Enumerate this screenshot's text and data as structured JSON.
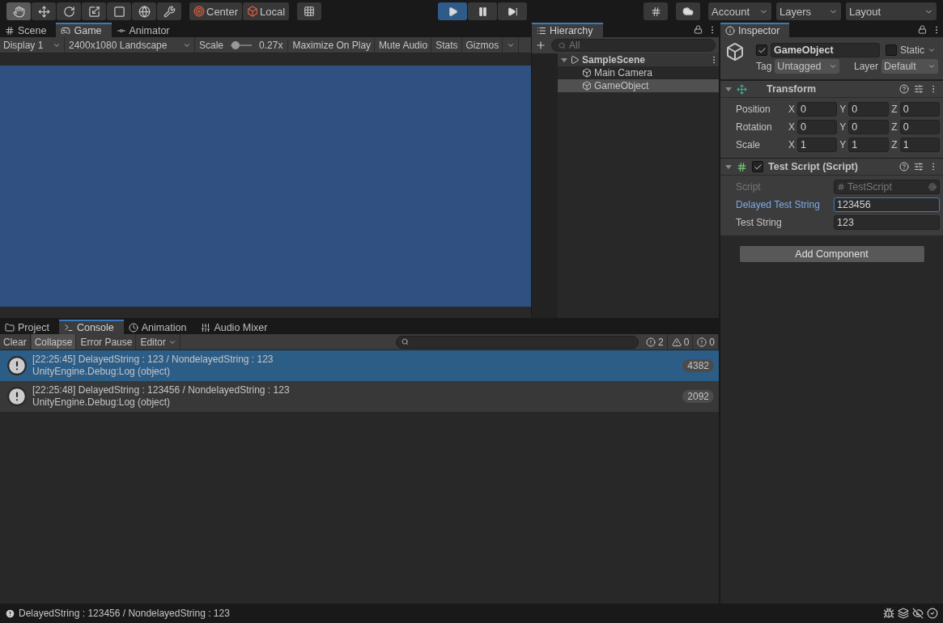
{
  "toolbar": {
    "tools": [
      {
        "kind": "hand",
        "selected": true
      },
      {
        "kind": "move",
        "selected": false
      },
      {
        "kind": "rotate",
        "selected": false
      },
      {
        "kind": "scale",
        "selected": false
      },
      {
        "kind": "rect",
        "selected": false
      },
      {
        "kind": "transform",
        "selected": false
      },
      {
        "kind": "custom",
        "selected": false
      }
    ],
    "pivot": [
      {
        "kind": "center",
        "label": "Center"
      },
      {
        "kind": "local",
        "label": "Local"
      }
    ],
    "play": [
      {
        "kind": "play",
        "selected": true
      },
      {
        "kind": "pause",
        "selected": false
      },
      {
        "kind": "step",
        "selected": false
      }
    ],
    "menus": [
      "Account",
      "Layers",
      "Layout"
    ]
  },
  "game_panel": {
    "tabs": [
      {
        "kind": "scene",
        "label": "Scene",
        "selected": false
      },
      {
        "kind": "game",
        "label": "Game",
        "selected": true
      },
      {
        "kind": "animator",
        "label": "Animator",
        "selected": false
      }
    ],
    "display": "Display 1",
    "resolution": "2400x1080 Landscape",
    "scale_label": "Scale",
    "scale": {
      "level": 0.05
    },
    "scale_reading": "0.27x",
    "buttons": [
      "Maximize On Play",
      "Mute Audio",
      "Stats",
      "Gizmos"
    ]
  },
  "hierarchy": {
    "title": "Hierarchy",
    "search": {
      "placeholder": "All"
    },
    "tree": [
      {
        "label": "SampleScene",
        "expanded": true,
        "selected": false,
        "children": [
          {
            "label": "Main Camera",
            "selected": false
          },
          {
            "label": "GameObject",
            "selected": true
          }
        ]
      }
    ]
  },
  "inspector": {
    "title": "Inspector",
    "object": {
      "active": true,
      "name": "GameObject",
      "static": false,
      "static_label": "Static",
      "tag_label": "Tag",
      "tag": "Untagged",
      "layer_label": "Layer",
      "layer": "Default"
    },
    "transform": {
      "title": "Transform",
      "rows": [
        {
          "label": "Position",
          "values": [
            {
              "axis": "X",
              "value": "0"
            },
            {
              "axis": "Y",
              "value": "0"
            },
            {
              "axis": "Z",
              "value": "0"
            }
          ]
        },
        {
          "label": "Rotation",
          "values": [
            {
              "axis": "X",
              "value": "0"
            },
            {
              "axis": "Y",
              "value": "0"
            },
            {
              "axis": "Z",
              "value": "0"
            }
          ]
        },
        {
          "label": "Scale",
          "values": [
            {
              "axis": "X",
              "value": "1"
            },
            {
              "axis": "Y",
              "value": "1"
            },
            {
              "axis": "Z",
              "value": "1"
            }
          ]
        }
      ]
    },
    "script": {
      "title": "Test Script (Script)",
      "enabled": true,
      "fields": [
        {
          "kind": "object",
          "label": "Script",
          "value": "TestScript",
          "disabled": true,
          "focused": false
        },
        {
          "kind": "text",
          "label": "Delayed Test String",
          "value": "123456",
          "disabled": false,
          "focused": true
        },
        {
          "kind": "text",
          "label": "Test String",
          "value": "123",
          "disabled": false,
          "focused": false
        }
      ]
    },
    "add_button": "Add Component"
  },
  "console_panel": {
    "tabs": [
      {
        "kind": "project",
        "label": "Project",
        "selected": false
      },
      {
        "kind": "console",
        "label": "Console",
        "selected": true
      },
      {
        "kind": "animation",
        "label": "Animation",
        "selected": false
      },
      {
        "kind": "mixer",
        "label": "Audio Mixer",
        "selected": false
      }
    ],
    "buttons": [
      {
        "label": "Clear",
        "on": false
      },
      {
        "label": "Collapse",
        "on": true
      },
      {
        "label": "Error Pause",
        "on": false
      }
    ],
    "editor": "Editor",
    "counts": [
      {
        "kind": "log",
        "count": "2"
      },
      {
        "kind": "warning",
        "count": "0"
      },
      {
        "kind": "error",
        "count": "0"
      }
    ],
    "entries": [
      {
        "message": "[22:25:45] DelayedString : 123 / NondelayedString : 123",
        "trace": "UnityEngine.Debug:Log (object)",
        "count": "4382",
        "selected": true
      },
      {
        "message": "[22:25:48] DelayedString : 123456 / NondelayedString : 123",
        "trace": "UnityEngine.Debug:Log (object)",
        "count": "2092",
        "selected": false
      }
    ]
  },
  "status_bar": {
    "message": "DelayedString : 123456 / NondelayedString : 123"
  }
}
